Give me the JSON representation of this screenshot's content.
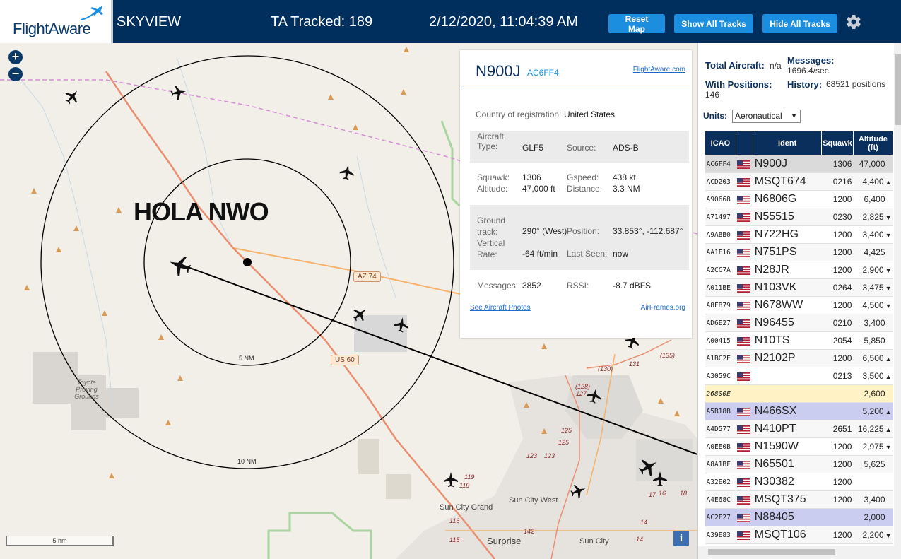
{
  "header": {
    "logo": "FlightAware",
    "app_title": "SKYVIEW",
    "tracked": "TA Tracked: 189",
    "clock": "2/12/2020, 11:04:39 AM",
    "buttons": {
      "reset_map": "Reset Map",
      "show_all": "Show All Tracks",
      "hide_all": "Hide All Tracks"
    },
    "settings_icon": "gear-icon"
  },
  "map": {
    "zoom_in": "+",
    "zoom_out": "−",
    "overlay_text": "HOLA NWO",
    "ring_labels": {
      "inner": "5 NM",
      "outer": "10 NM"
    },
    "road_shields": {
      "az74": "AZ 74",
      "us60": "US 60"
    },
    "places": {
      "toyota": "Toyota Proving Grounds",
      "sun_city_grand": "Sun City Grand",
      "sun_city_west": "Sun City West",
      "sun_city": "Sun City",
      "surprise": "Surprise"
    },
    "road_numbers": [
      "(130)",
      "131",
      "(135)",
      "(128)",
      "127",
      "125",
      "125",
      "123",
      "123",
      "119",
      "119",
      "116",
      "115",
      "142",
      "17",
      "16",
      "18",
      "14",
      "14"
    ],
    "scale": "5 nm",
    "info_button": "i"
  },
  "selected": {
    "ident": "N900J",
    "icao": "AC6FF4",
    "fa_link": "FlightAware.com",
    "country_label": "Country of registration:",
    "country": "United States",
    "aircraft_type_label": "Aircraft Type:",
    "aircraft_type": "GLF5",
    "source_label": "Source:",
    "source": "ADS-B",
    "squawk_label": "Squawk:",
    "squawk": "1306",
    "gspeed_label": "Gspeed:",
    "gspeed": "438 kt",
    "altitude_label": "Altitude:",
    "altitude": "47,000 ft",
    "distance_label": "Distance:",
    "distance": "3.3 NM",
    "ground_track_label": "Ground track:",
    "ground_track": "290° (West)",
    "position_label": "Position:",
    "position": "33.853°, -112.687°",
    "vertical_rate_label": "Vertical Rate:",
    "vertical_rate": "-64 ft/min",
    "last_seen_label": "Last Seen:",
    "last_seen": "now",
    "messages_label": "Messages:",
    "messages": "3852",
    "rssi_label": "RSSI:",
    "rssi": "-8.7 dBFS",
    "photos_link": "See Aircraft Photos",
    "airframes_link": "AirFrames.org"
  },
  "stats": {
    "total_label": "Total Aircraft:",
    "total": "n/a",
    "messages_label": "Messages:",
    "messages": "1696.4/sec",
    "with_pos_label": "With Positions:",
    "with_pos": "146",
    "history_label": "History:",
    "history": "68521 positions",
    "units_label": "Units:",
    "units_value": "Aeronautical"
  },
  "table": {
    "headers": {
      "icao": "ICAO",
      "flag": "",
      "ident": "Ident",
      "squawk": "Squawk",
      "altitude": "Altitude (ft)"
    },
    "rows": [
      {
        "icao": "AC6FF4",
        "ident": "N900J",
        "squawk": "1306",
        "alt": "47,000",
        "trend": "",
        "kind": "sel",
        "flag": true
      },
      {
        "icao": "ACD203",
        "ident": "MSQT674",
        "squawk": "0216",
        "alt": "4,400",
        "trend": "▲",
        "kind": "",
        "flag": true
      },
      {
        "icao": "A90668",
        "ident": "N6806G",
        "squawk": "1200",
        "alt": "6,400",
        "trend": "",
        "kind": "",
        "flag": true
      },
      {
        "icao": "A71497",
        "ident": "N55515",
        "squawk": "0230",
        "alt": "2,825",
        "trend": "▼",
        "kind": "",
        "flag": true
      },
      {
        "icao": "A9ABB0",
        "ident": "N722HG",
        "squawk": "1200",
        "alt": "3,400",
        "trend": "▼",
        "kind": "",
        "flag": true
      },
      {
        "icao": "AA1F16",
        "ident": "N751PS",
        "squawk": "1200",
        "alt": "4,425",
        "trend": "",
        "kind": "",
        "flag": true
      },
      {
        "icao": "A2CC7A",
        "ident": "N28JR",
        "squawk": "1200",
        "alt": "2,900",
        "trend": "▼",
        "kind": "",
        "flag": true
      },
      {
        "icao": "A011BE",
        "ident": "N103VK",
        "squawk": "0264",
        "alt": "3,475",
        "trend": "▼",
        "kind": "",
        "flag": true
      },
      {
        "icao": "A8FB79",
        "ident": "N678WW",
        "squawk": "1200",
        "alt": "4,500",
        "trend": "▼",
        "kind": "",
        "flag": true
      },
      {
        "icao": "AD6E27",
        "ident": "N96455",
        "squawk": "0210",
        "alt": "3,400",
        "trend": "",
        "kind": "",
        "flag": true
      },
      {
        "icao": "A00415",
        "ident": "N10TS",
        "squawk": "2054",
        "alt": "5,850",
        "trend": "",
        "kind": "",
        "flag": true
      },
      {
        "icao": "A1BC2E",
        "ident": "N2102P",
        "squawk": "1200",
        "alt": "6,500",
        "trend": "▲",
        "kind": "",
        "flag": true
      },
      {
        "icao": "A3059C",
        "ident": "",
        "squawk": "0213",
        "alt": "3,500",
        "trend": "▲",
        "kind": "",
        "flag": true
      },
      {
        "icao": "26800E",
        "ident": "",
        "squawk": "",
        "alt": "2,600",
        "trend": "",
        "kind": "tisb",
        "flag": false
      },
      {
        "icao": "A5B18B",
        "ident": "N466SX",
        "squawk": "",
        "alt": "5,200",
        "trend": "▲",
        "kind": "mlat",
        "flag": true
      },
      {
        "icao": "A4D577",
        "ident": "N410PT",
        "squawk": "2651",
        "alt": "16,225",
        "trend": "▲",
        "kind": "",
        "flag": true
      },
      {
        "icao": "A0EE0B",
        "ident": "N1590W",
        "squawk": "1200",
        "alt": "2,975",
        "trend": "▼",
        "kind": "",
        "flag": true
      },
      {
        "icao": "A8A1BF",
        "ident": "N65501",
        "squawk": "1200",
        "alt": "5,625",
        "trend": "",
        "kind": "",
        "flag": true
      },
      {
        "icao": "A32E02",
        "ident": "N30382",
        "squawk": "1200",
        "alt": "",
        "trend": "",
        "kind": "",
        "flag": true
      },
      {
        "icao": "A4E68C",
        "ident": "MSQT375",
        "squawk": "1200",
        "alt": "3,400",
        "trend": "",
        "kind": "",
        "flag": true
      },
      {
        "icao": "AC2F27",
        "ident": "N88405",
        "squawk": "",
        "alt": "2,000",
        "trend": "",
        "kind": "mlat",
        "flag": true
      },
      {
        "icao": "A39E83",
        "ident": "MSQT106",
        "squawk": "1200",
        "alt": "2,200",
        "trend": "▼",
        "kind": "",
        "flag": true
      }
    ]
  },
  "colors": {
    "header_bg": "#002f5d",
    "button": "#1c8ee0",
    "map_bg": "#f2efe9",
    "selected_row": "#dadada",
    "mlat_row": "#cbcdf0",
    "tisb_row": "#fff3c6"
  }
}
